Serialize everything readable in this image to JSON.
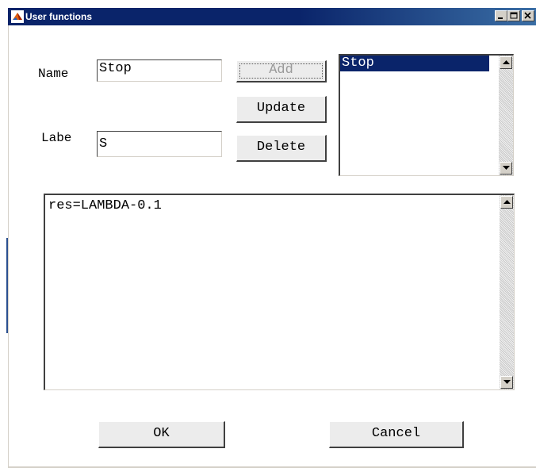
{
  "window": {
    "title": "User functions",
    "controls": [
      "minimize-icon",
      "maximize-icon",
      "close-icon"
    ]
  },
  "form": {
    "name_label": "Name",
    "name_value": "Stop",
    "label_label": "Labe",
    "label_value": "S"
  },
  "buttons": {
    "add": "Add",
    "update": "Update",
    "delete": "Delete",
    "ok": "OK",
    "cancel": "Cancel"
  },
  "function_list": {
    "items": [
      "Stop"
    ],
    "selected_index": 0
  },
  "code": {
    "text": "res=LAMBDA-0.1"
  },
  "colors": {
    "selection": "#0a246a",
    "titlebar": "#0a246a"
  }
}
